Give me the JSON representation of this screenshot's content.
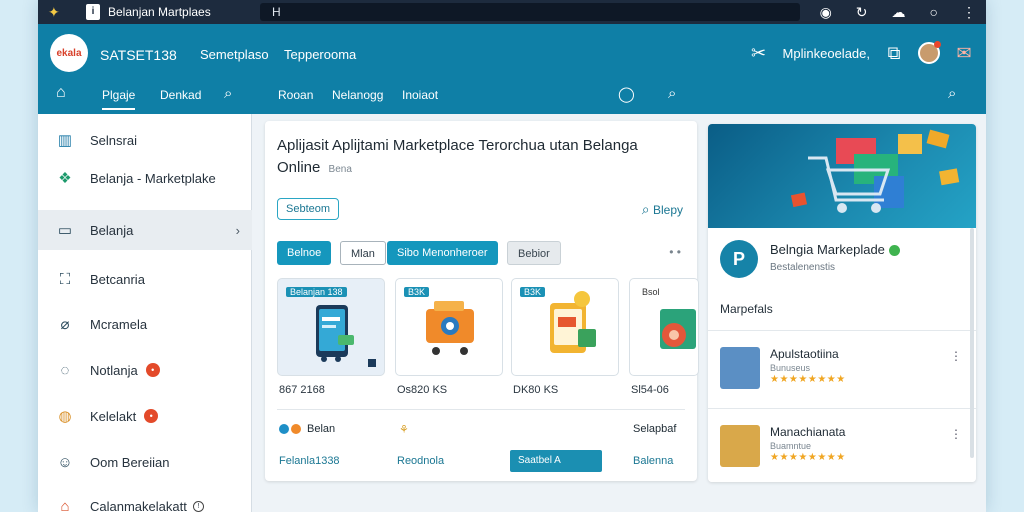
{
  "browser": {
    "tab_title": "Belanjan Martplaes",
    "tab_close": "✕",
    "address": "H",
    "icons": [
      "target-icon",
      "refresh-icon",
      "cloud-icon",
      "circle-icon",
      "menu-icon"
    ]
  },
  "header": {
    "brand_logo": "ekala",
    "brand_name": "SATSET138",
    "links": [
      "Semetplaso",
      "Tepperooma"
    ],
    "right_label": "Mplinkeoelade,",
    "nav": [
      "Plgaje",
      "Denkad",
      "Rooan",
      "Nelanogg",
      "Inoiaot"
    ]
  },
  "sidebar": {
    "items": [
      {
        "label": "Selnsrai",
        "icon": "chart-icon"
      },
      {
        "label": "Belanja - Marketplake",
        "icon": "package-icon"
      },
      {
        "label": "Belanja",
        "icon": "calendar-icon"
      },
      {
        "label": "Betcanria",
        "icon": "bag-icon"
      },
      {
        "label": "Mcramela",
        "icon": "tag-icon"
      },
      {
        "label": "Notlanja",
        "icon": "chat-icon",
        "badge": "•"
      },
      {
        "label": "Kelelakt",
        "icon": "chart-icon",
        "badge": "•"
      },
      {
        "label": "Oom Bereiian",
        "icon": "people-icon"
      },
      {
        "label": "Calanmakelakatt",
        "icon": "shop-icon",
        "ring": "!"
      }
    ]
  },
  "center": {
    "title": "Aplijasit Aplijtami Marketplace Terorchua utan Belanga Online",
    "meta": "Bena",
    "chip": "Sebteom",
    "search_label": "Blepy",
    "filters": [
      "Belnoe",
      "Mlan",
      "Sibo Menonheroer",
      "Bebior"
    ],
    "more": "• •",
    "cards": [
      {
        "tag": "Belanjan 138",
        "color": "#e7eff7"
      },
      {
        "tag": "B3K",
        "color": "#ffffff"
      },
      {
        "tag": "B3K",
        "color": "#ffffff"
      },
      {
        "tag": "Bsol",
        "color": "#ffffff"
      }
    ],
    "prices": [
      "867 2168",
      "Os820 KS",
      "DK80 KS",
      "Sl54-06"
    ],
    "footer_1": "Belan",
    "footer_2": "Selapbaf",
    "links": [
      "Felanla1338",
      "Reodnola",
      "Balenna"
    ],
    "buy_button": "Saatbel A"
  },
  "right": {
    "store_logo": "P",
    "store_name": "Belngia Markeplade",
    "store_sub": "Bestalenenstis",
    "section_title": "Marpefals",
    "products": [
      {
        "name": "Apulstaotiina",
        "seller": "Bunuseus",
        "stars": "★★★★★★★★",
        "color": "#5b8fc4"
      },
      {
        "name": "Manachianata",
        "seller": "Buamntue",
        "stars": "★★★★★★★★",
        "color": "#d9a84a"
      }
    ]
  }
}
